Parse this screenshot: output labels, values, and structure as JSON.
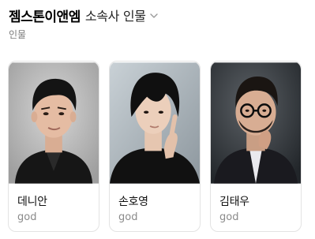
{
  "header": {
    "agency_name": "젬스톤이앤엠",
    "category": "소속사 인물"
  },
  "subtitle": "인물",
  "people": [
    {
      "name": "데니안",
      "role": "god"
    },
    {
      "name": "손호영",
      "role": "god"
    },
    {
      "name": "김태우",
      "role": "god"
    }
  ],
  "icons": {
    "dropdown": "chevron-down-icon",
    "photo": "person-photo"
  },
  "colors": {
    "text_primary": "#111111",
    "text_secondary": "#7b7b7b",
    "card_border": "#e3e3e3"
  }
}
